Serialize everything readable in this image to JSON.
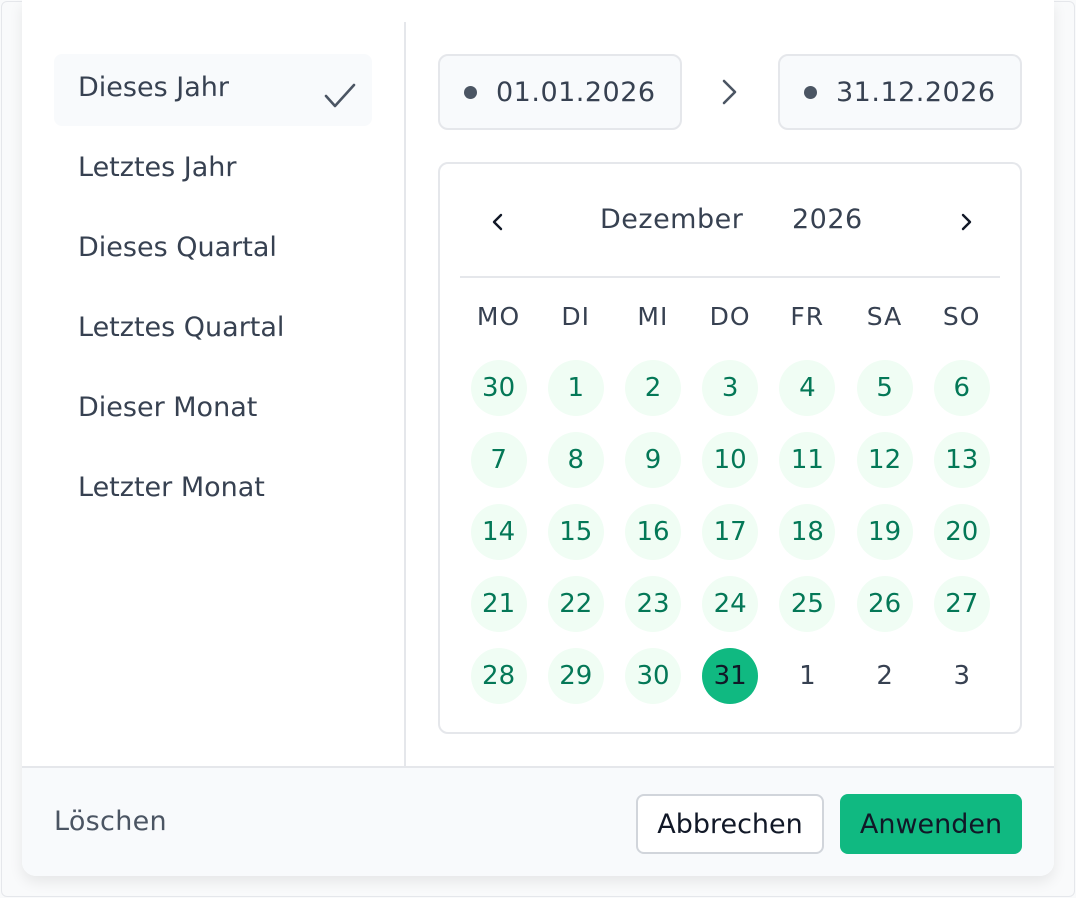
{
  "presets": [
    {
      "label": "Dieses Jahr",
      "active": true
    },
    {
      "label": "Letztes Jahr",
      "active": false
    },
    {
      "label": "Dieses Quartal",
      "active": false
    },
    {
      "label": "Letztes Quartal",
      "active": false
    },
    {
      "label": "Dieser Monat",
      "active": false
    },
    {
      "label": "Letzter Monat",
      "active": false
    }
  ],
  "range": {
    "start": "01.01.2026",
    "end": "31.12.2026"
  },
  "calendar": {
    "month": "Dezember",
    "year": "2026",
    "weekdays": [
      "MO",
      "DI",
      "MI",
      "DO",
      "FR",
      "SA",
      "SO"
    ],
    "weeks": [
      [
        {
          "d": "30",
          "s": "in-range"
        },
        {
          "d": "1",
          "s": "in-range"
        },
        {
          "d": "2",
          "s": "in-range"
        },
        {
          "d": "3",
          "s": "in-range"
        },
        {
          "d": "4",
          "s": "in-range"
        },
        {
          "d": "5",
          "s": "in-range"
        },
        {
          "d": "6",
          "s": "in-range"
        }
      ],
      [
        {
          "d": "7",
          "s": "in-range"
        },
        {
          "d": "8",
          "s": "in-range"
        },
        {
          "d": "9",
          "s": "in-range"
        },
        {
          "d": "10",
          "s": "in-range"
        },
        {
          "d": "11",
          "s": "in-range"
        },
        {
          "d": "12",
          "s": "in-range"
        },
        {
          "d": "13",
          "s": "in-range"
        }
      ],
      [
        {
          "d": "14",
          "s": "in-range"
        },
        {
          "d": "15",
          "s": "in-range"
        },
        {
          "d": "16",
          "s": "in-range"
        },
        {
          "d": "17",
          "s": "in-range"
        },
        {
          "d": "18",
          "s": "in-range"
        },
        {
          "d": "19",
          "s": "in-range"
        },
        {
          "d": "20",
          "s": "in-range"
        }
      ],
      [
        {
          "d": "21",
          "s": "in-range"
        },
        {
          "d": "22",
          "s": "in-range"
        },
        {
          "d": "23",
          "s": "in-range"
        },
        {
          "d": "24",
          "s": "in-range"
        },
        {
          "d": "25",
          "s": "in-range"
        },
        {
          "d": "26",
          "s": "in-range"
        },
        {
          "d": "27",
          "s": "in-range"
        }
      ],
      [
        {
          "d": "28",
          "s": "in-range"
        },
        {
          "d": "29",
          "s": "in-range"
        },
        {
          "d": "30",
          "s": "in-range"
        },
        {
          "d": "31",
          "s": "selected"
        },
        {
          "d": "1",
          "s": "outside"
        },
        {
          "d": "2",
          "s": "outside"
        },
        {
          "d": "3",
          "s": "outside"
        }
      ]
    ]
  },
  "footer": {
    "clear_label": "Löschen",
    "cancel_label": "Abbrechen",
    "apply_label": "Anwenden"
  },
  "icons": {
    "preset_selected": "check-icon",
    "range_separator": "chevron-right-icon",
    "prev_month": "chevron-left-icon",
    "next_month": "chevron-right-icon"
  },
  "colors": {
    "accent": "#10b981",
    "range_bg": "#f0fdf4",
    "range_text": "#047857"
  }
}
